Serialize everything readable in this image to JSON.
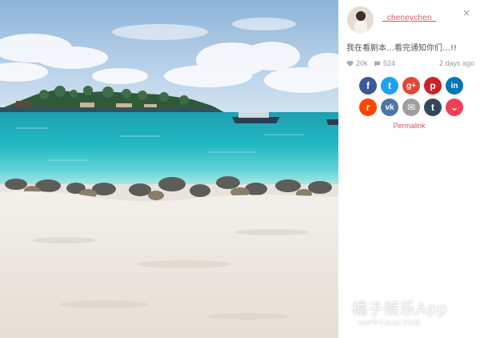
{
  "post": {
    "username": "_cheneychen_",
    "caption": "我在看剧本…看完通知你们…!!",
    "likes": "20k",
    "comments": "524",
    "time": "2 days ago",
    "permalink": "Permalink",
    "close_glyph": "×"
  },
  "share_buttons_row1": [
    {
      "name": "facebook",
      "glyph": "f",
      "color": "#3b5998"
    },
    {
      "name": "twitter",
      "glyph": "t",
      "color": "#1da1f2"
    },
    {
      "name": "google-plus",
      "glyph": "g+",
      "color": "#dd4b39"
    },
    {
      "name": "pinterest",
      "glyph": "p",
      "color": "#cb2027"
    },
    {
      "name": "linkedin",
      "glyph": "in",
      "color": "#0077b5"
    }
  ],
  "share_buttons_row2": [
    {
      "name": "reddit",
      "glyph": "r",
      "color": "#ff4500"
    },
    {
      "name": "vk",
      "glyph": "vk",
      "color": "#4a76a8"
    },
    {
      "name": "email",
      "glyph": "✉",
      "color": "#9e9e9e"
    },
    {
      "name": "tumblr",
      "glyph": "t",
      "color": "#35465c"
    },
    {
      "name": "pocket",
      "glyph": "⌄",
      "color": "#ef4056"
    }
  ],
  "watermark": {
    "main": "橘子娱乐App",
    "sub": "HAPPYJUZI.COM"
  },
  "colors": {
    "accent": "#d3546b",
    "muted": "#999999"
  }
}
